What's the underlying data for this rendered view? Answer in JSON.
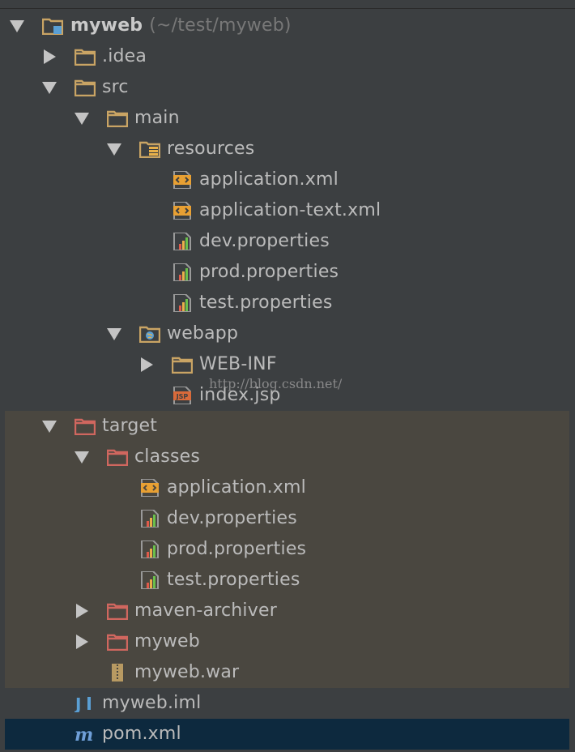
{
  "project": {
    "name": "myweb",
    "path_hint": "(~/test/myweb)"
  },
  "watermark": "http://blog.csdn.net/",
  "colors": {
    "background": "#3c3f41",
    "excluded_background": "#4a4740",
    "selected_background": "#0d293e",
    "folder": "#c9a464",
    "excluded_folder": "#d0675f"
  },
  "tree": [
    {
      "label": "myweb",
      "icon": "module-folder-icon",
      "expanded": true
    },
    {
      "label": ".idea",
      "icon": "folder-icon",
      "expanded": false
    },
    {
      "label": "src",
      "icon": "folder-icon",
      "expanded": true
    },
    {
      "label": "main",
      "icon": "folder-icon",
      "expanded": true
    },
    {
      "label": "resources",
      "icon": "resources-folder-icon",
      "expanded": true
    },
    {
      "label": "application.xml",
      "icon": "xml-file-icon"
    },
    {
      "label": "application-text.xml",
      "icon": "xml-file-icon"
    },
    {
      "label": "dev.properties",
      "icon": "properties-file-icon"
    },
    {
      "label": "prod.properties",
      "icon": "properties-file-icon"
    },
    {
      "label": "test.properties",
      "icon": "properties-file-icon"
    },
    {
      "label": "webapp",
      "icon": "web-folder-icon",
      "expanded": true
    },
    {
      "label": "WEB-INF",
      "icon": "folder-icon",
      "expanded": false
    },
    {
      "label": "index.jsp",
      "icon": "jsp-file-icon"
    },
    {
      "label": "target",
      "icon": "excluded-folder-icon",
      "expanded": true
    },
    {
      "label": "classes",
      "icon": "excluded-folder-icon",
      "expanded": true
    },
    {
      "label": "application.xml",
      "icon": "xml-file-icon"
    },
    {
      "label": "dev.properties",
      "icon": "properties-file-icon"
    },
    {
      "label": "prod.properties",
      "icon": "properties-file-icon"
    },
    {
      "label": "test.properties",
      "icon": "properties-file-icon"
    },
    {
      "label": "maven-archiver",
      "icon": "excluded-folder-icon",
      "expanded": false
    },
    {
      "label": "myweb",
      "icon": "excluded-folder-icon",
      "expanded": false
    },
    {
      "label": "myweb.war",
      "icon": "archive-file-icon"
    },
    {
      "label": "myweb.iml",
      "icon": "iml-file-icon"
    },
    {
      "label": "pom.xml",
      "icon": "maven-file-icon"
    }
  ]
}
